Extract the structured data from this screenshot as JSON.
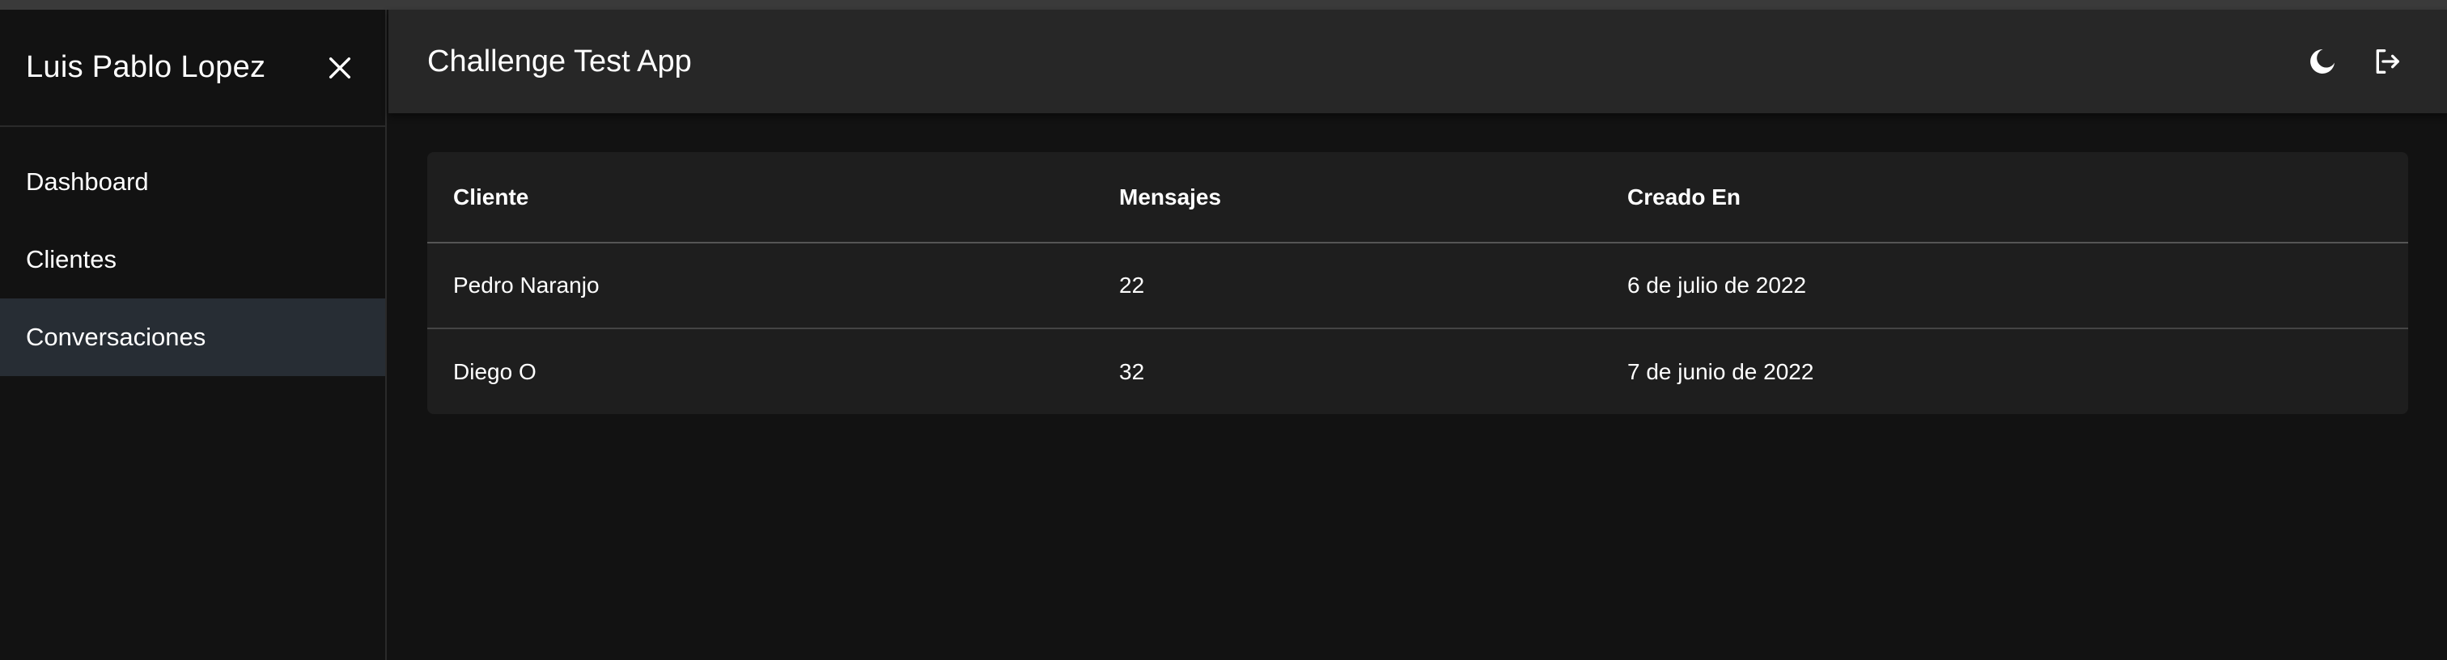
{
  "sidebar": {
    "user_name": "Luis Pablo Lopez",
    "close_icon": "close-icon",
    "items": [
      {
        "label": "Dashboard",
        "active": false
      },
      {
        "label": "Clientes",
        "active": false
      },
      {
        "label": "Conversaciones",
        "active": true
      }
    ]
  },
  "header": {
    "title": "Challenge Test App",
    "theme_icon": "moon-icon",
    "logout_icon": "logout-icon"
  },
  "table": {
    "columns": [
      "Cliente",
      "Mensajes",
      "Creado En"
    ],
    "rows": [
      [
        "Pedro Naranjo",
        "22",
        "6 de julio de 2022"
      ],
      [
        "Diego O",
        "32",
        "7 de junio de 2022"
      ]
    ]
  },
  "colors": {
    "background": "#121212",
    "appbar": "#272727",
    "card": "#1e1e1e",
    "active_nav": "#272d34",
    "text": "#ffffff"
  }
}
